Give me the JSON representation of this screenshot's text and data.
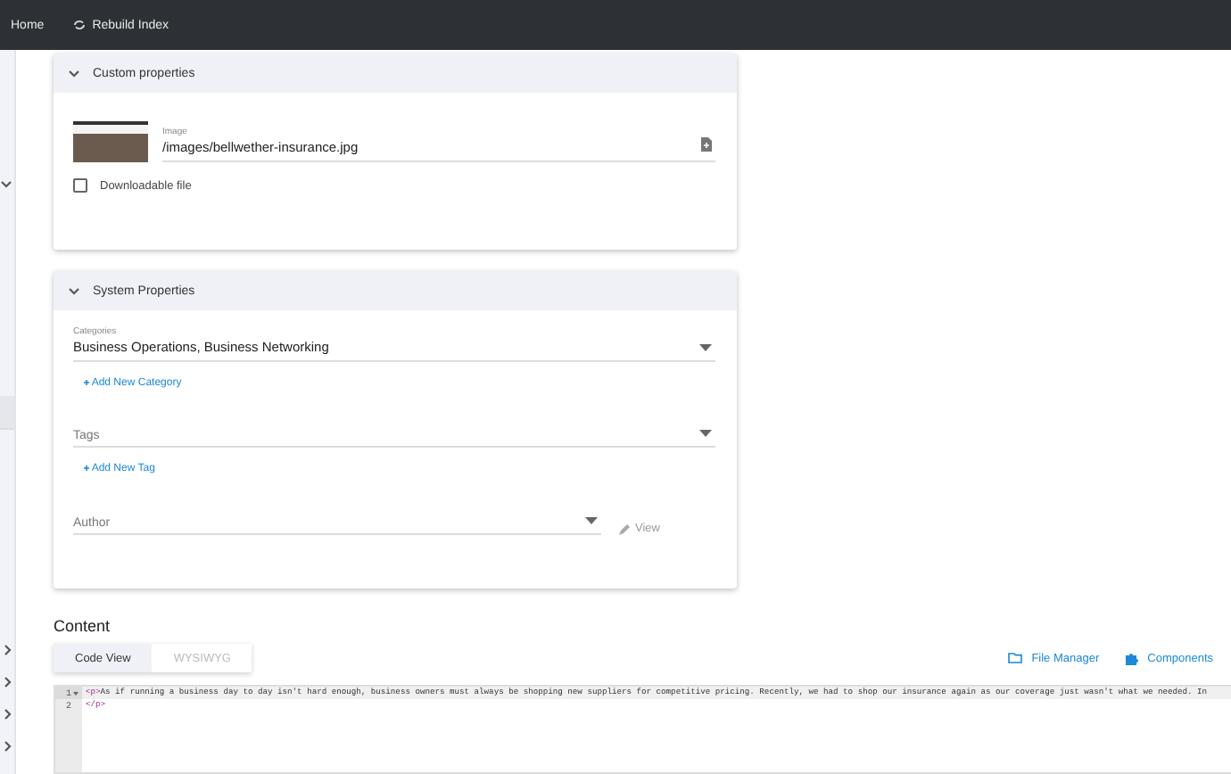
{
  "topbar": {
    "items": [
      {
        "label": "Home",
        "kind": "link"
      },
      {
        "label": "Rebuild Index",
        "kind": "action"
      }
    ]
  },
  "sidebar": {
    "items": [
      {
        "kind": "group",
        "expanded": true
      },
      {
        "kind": "link",
        "selected": true
      },
      {
        "kind": "group",
        "expanded": false
      },
      {
        "kind": "group",
        "expanded": false
      },
      {
        "kind": "group",
        "expanded": false
      },
      {
        "kind": "group",
        "expanded": false
      }
    ]
  },
  "custom_properties": {
    "title": "Custom properties",
    "expanded": true,
    "image": {
      "label": "Image",
      "value": "/images/bellwether-insurance.jpg"
    },
    "downloadable": {
      "label": "Downloadable file",
      "checked": false
    }
  },
  "system_properties": {
    "title": "System Properties",
    "expanded": true,
    "categories": {
      "label": "Categories",
      "value": "Business Operations, Business Networking"
    },
    "add_category": "Add New Category",
    "tags": {
      "placeholder": "Tags"
    },
    "add_tag": "Add New Tag",
    "author": {
      "placeholder": "Author"
    },
    "view": "View"
  },
  "content": {
    "title": "Content",
    "tabs": [
      {
        "label": "Code View",
        "selected": true
      },
      {
        "label": "WYSIWYG",
        "selected": false
      }
    ],
    "actions": [
      {
        "label": "File Manager",
        "kind": "folder"
      },
      {
        "label": "Components",
        "kind": "puzzle"
      }
    ],
    "code_lines": [
      {
        "number": "1",
        "foldable": true,
        "tokens": [
          {
            "kind": "tag",
            "text": "<p>"
          },
          {
            "kind": "text",
            "text": "As if running a business day to day isn't hard enough, business owners must always be shopping new suppliers for competitive pricing. Recently, we had to shop our insurance again as our coverage just wasn't what we needed. In"
          }
        ]
      },
      {
        "number": "2",
        "foldable": false,
        "tokens": [
          {
            "kind": "tag",
            "text": "</p>"
          }
        ]
      }
    ]
  }
}
